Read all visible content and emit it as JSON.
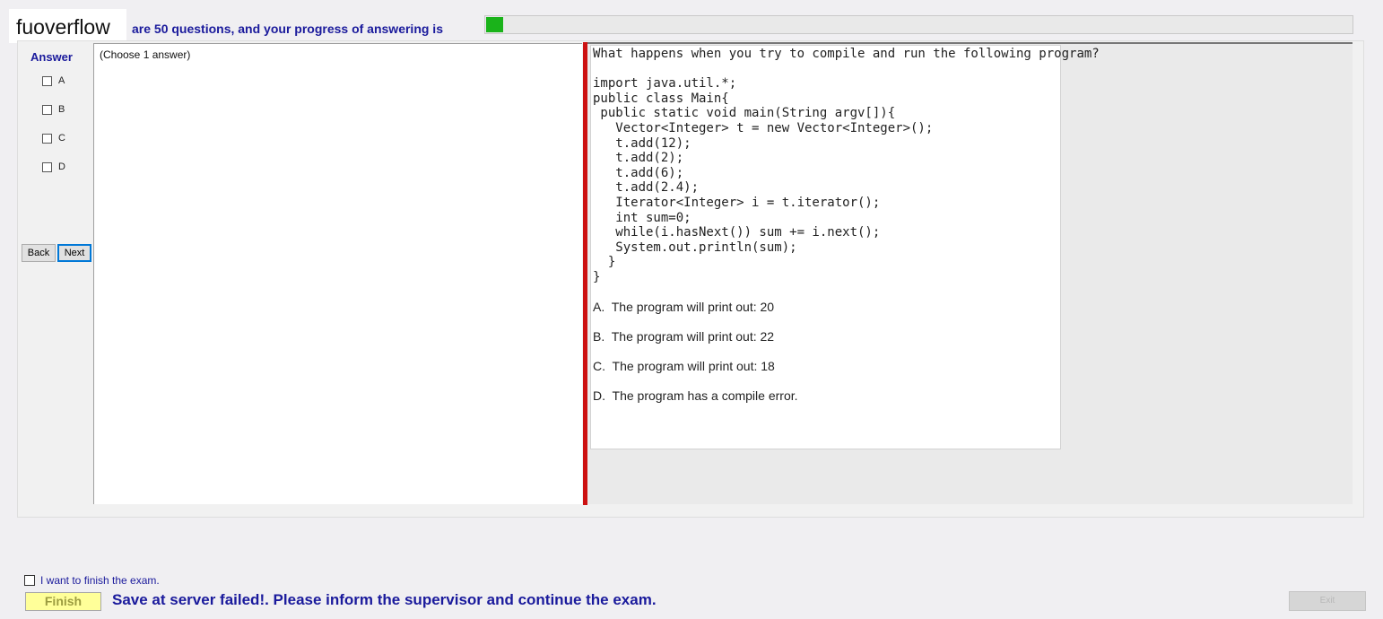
{
  "header": {
    "brand": "fuoverflow",
    "progress_text": "are 50 questions, and your progress of answering is",
    "progress_fraction": 0.02,
    "progress_color": "#1ab31a"
  },
  "answer_panel": {
    "title": "Answer",
    "options": [
      {
        "label": "A",
        "checked": false
      },
      {
        "label": "B",
        "checked": false
      },
      {
        "label": "C",
        "checked": false
      },
      {
        "label": "D",
        "checked": false
      }
    ],
    "back_label": "Back",
    "next_label": "Next",
    "hint": "(Choose 1 answer)"
  },
  "question": {
    "text": "What happens when you try to compile and run the following program?\n\nimport java.util.*;\npublic class Main{\n public static void main(String argv[]){\n   Vector<Integer> t = new Vector<Integer>();\n   t.add(12);\n   t.add(2);\n   t.add(6);\n   t.add(2.4);\n   Iterator<Integer> i = t.iterator();\n   int sum=0;\n   while(i.hasNext()) sum += i.next();\n   System.out.println(sum);\n  }\n}",
    "choices": [
      "A.  The program will print out: 20",
      "B.  The program will print out: 22",
      "C.  The program will print out: 18",
      "D.  The program has a compile error."
    ]
  },
  "footer": {
    "finish_check_label": "I want to finish the exam.",
    "finish_label": "Finish",
    "status_message": "Save at server failed!. Please inform the supervisor and continue the exam.",
    "exit_label": "Exit"
  }
}
